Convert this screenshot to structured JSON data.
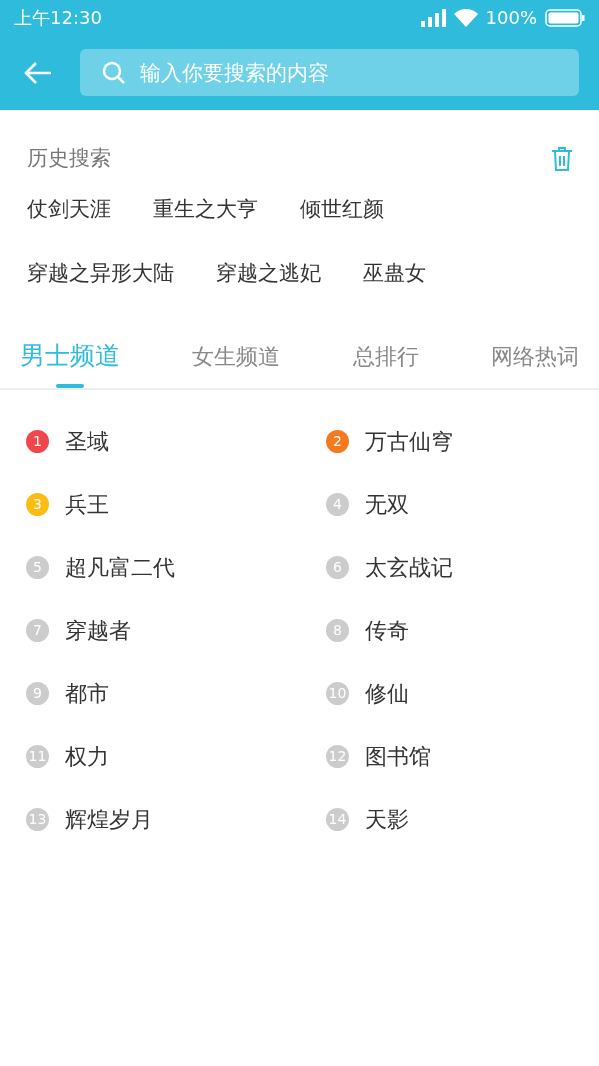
{
  "status_bar": {
    "time": "上午12:30",
    "battery": "100%"
  },
  "search": {
    "placeholder": "输入你要搜索的内容"
  },
  "history": {
    "title": "历史搜索",
    "tags": [
      "仗剑天涯",
      "重生之大亨",
      "倾世红颜",
      "穿越之异形大陆",
      "穿越之逃妃",
      "巫蛊女"
    ]
  },
  "tabs": [
    {
      "label": "男士频道",
      "selected": true
    },
    {
      "label": "女生频道",
      "selected": false
    },
    {
      "label": "总排行",
      "selected": false
    },
    {
      "label": "网络热词",
      "selected": false
    }
  ],
  "ranking": [
    {
      "rank": "1",
      "title": "圣域",
      "color": "#f0474d"
    },
    {
      "rank": "2",
      "title": "万古仙穹",
      "color": "#f57a1f"
    },
    {
      "rank": "3",
      "title": "兵王",
      "color": "#fbbd14"
    },
    {
      "rank": "4",
      "title": "无双",
      "color": "#cccccc"
    },
    {
      "rank": "5",
      "title": "超凡富二代",
      "color": "#cccccc"
    },
    {
      "rank": "6",
      "title": "太玄战记",
      "color": "#cccccc"
    },
    {
      "rank": "7",
      "title": "穿越者",
      "color": "#cccccc"
    },
    {
      "rank": "8",
      "title": "传奇",
      "color": "#cccccc"
    },
    {
      "rank": "9",
      "title": "都市",
      "color": "#cccccc"
    },
    {
      "rank": "10",
      "title": "修仙",
      "color": "#cccccc"
    },
    {
      "rank": "11",
      "title": "权力",
      "color": "#cccccc"
    },
    {
      "rank": "12",
      "title": "图书馆",
      "color": "#cccccc"
    },
    {
      "rank": "13",
      "title": "辉煌岁月",
      "color": "#cccccc"
    },
    {
      "rank": "14",
      "title": "天影",
      "color": "#cccccc"
    }
  ]
}
